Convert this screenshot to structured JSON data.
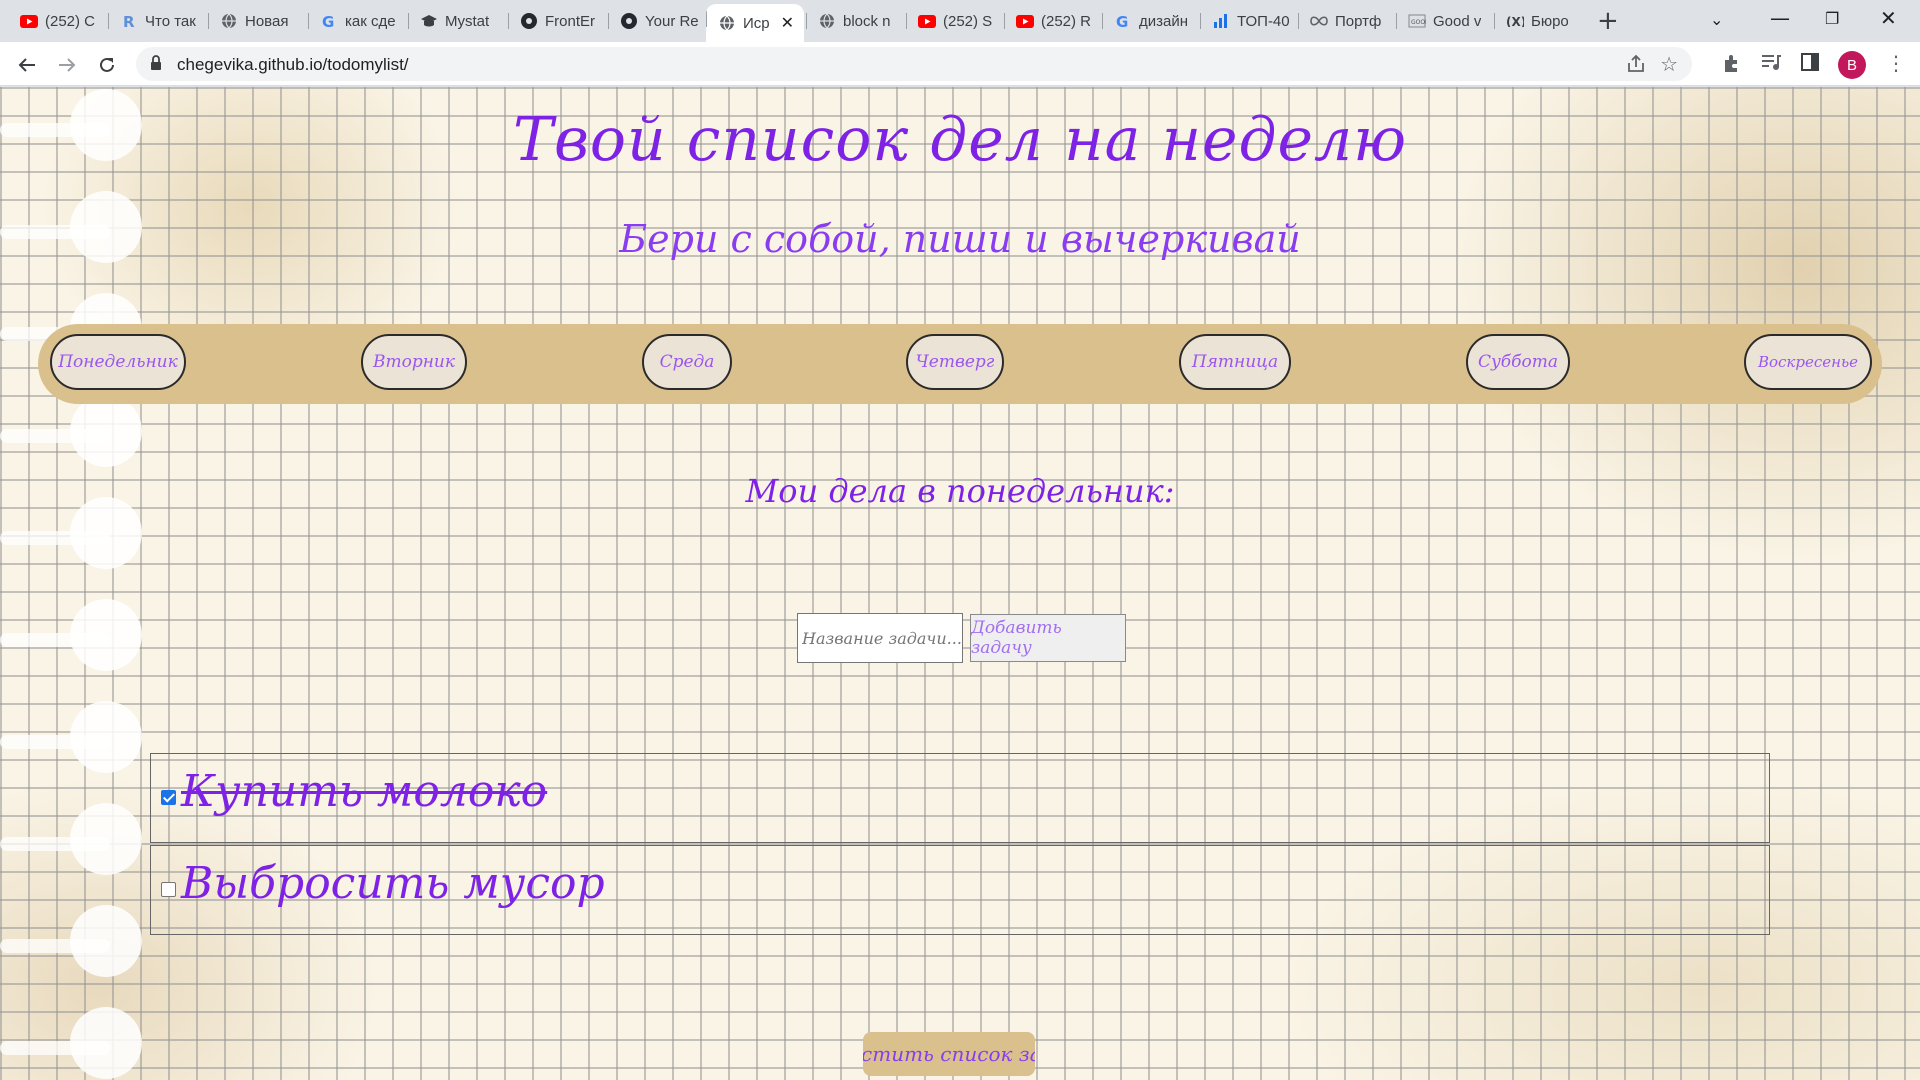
{
  "browser": {
    "tabs": [
      {
        "title": "(252) C",
        "icon": "youtube-icon"
      },
      {
        "title": "Что так",
        "icon": "r-logo-icon"
      },
      {
        "title": "Новая",
        "icon": "globe-icon"
      },
      {
        "title": "как сде",
        "icon": "google-icon"
      },
      {
        "title": "Mystat",
        "icon": "graduation-cap-icon"
      },
      {
        "title": "FrontEr",
        "icon": "github-icon"
      },
      {
        "title": "Your Re",
        "icon": "github-icon"
      },
      {
        "title": "Иср",
        "icon": "globe-icon"
      },
      {
        "title": "block n",
        "icon": "globe-icon"
      },
      {
        "title": "(252) S",
        "icon": "youtube-icon"
      },
      {
        "title": "(252) R",
        "icon": "youtube-icon"
      },
      {
        "title": "дизайн",
        "icon": "google-icon"
      },
      {
        "title": "ТОП-40",
        "icon": "bar-chart-icon"
      },
      {
        "title": "Портф",
        "icon": "infinity-icon"
      },
      {
        "title": "Good v",
        "icon": "good-studio-icon"
      },
      {
        "title": "Бюро",
        "icon": "bureau-icon"
      }
    ],
    "url": "chegevika.github.io/todomylist/",
    "profile_initial": "B",
    "colors": {
      "profile": "#c2185b",
      "youtube": "#ff0000"
    }
  },
  "page": {
    "title": "Твой список дел на неделю",
    "subtitle": "Бери с собой, пиши и вычеркивай",
    "days": [
      "Понедельник",
      "Вторник",
      "Среда",
      "Четверг",
      "Пятница",
      "Суббота",
      "Воскресенье"
    ],
    "day_heading": "Мои дела в понедельник:",
    "input_placeholder": "Название задачи...",
    "add_button": "Добавить задачу",
    "tasks": [
      {
        "text": "Купить молоко",
        "done": true
      },
      {
        "text": "Выбросить мусор",
        "done": false
      }
    ],
    "clear_button": "Очистить список задач",
    "colors": {
      "accent": "#7e22e6",
      "bar": "#d9c08d"
    }
  }
}
